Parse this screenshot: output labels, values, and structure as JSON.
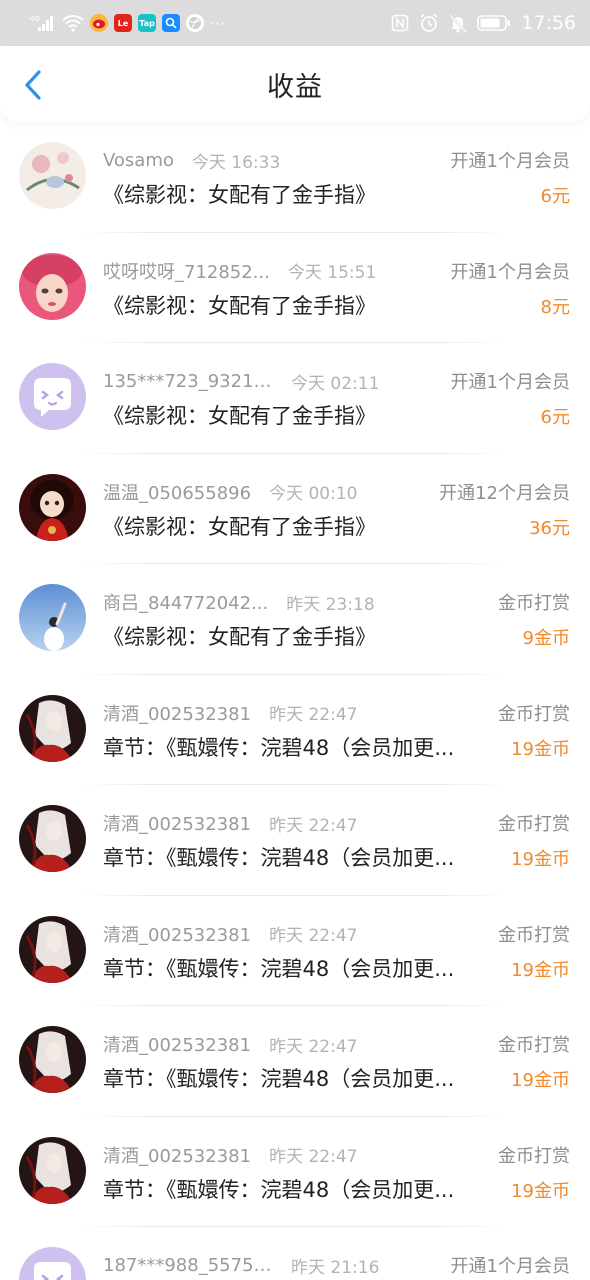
{
  "status_bar": {
    "network": "4G",
    "time": "17:56",
    "more": "···"
  },
  "header": {
    "title": "收益",
    "back_icon": "chevron-left-icon"
  },
  "colors": {
    "accent_back": "#2f8ef0",
    "amount": "#f08a2c"
  },
  "items": [
    {
      "user": "Vosamo",
      "time": "今天 16:33",
      "type": "开通1个月会员",
      "title": "《综影视：女配有了金手指》",
      "amount": "6元",
      "avatar": "avatar-floral"
    },
    {
      "user": "哎呀哎呀_712852...",
      "time": "今天 15:51",
      "type": "开通1个月会员",
      "title": "《综影视：女配有了金手指》",
      "amount": "8元",
      "avatar": "avatar-girl-pink"
    },
    {
      "user": "135***723_93219...",
      "time": "今天 02:11",
      "type": "开通1个月会员",
      "title": "《综影视：女配有了金手指》",
      "amount": "6元",
      "avatar": "avatar-default"
    },
    {
      "user": "温温_050655896",
      "time": "今天 00:10",
      "type": "开通12个月会员",
      "title": "《综影视：女配有了金手指》",
      "amount": "36元",
      "avatar": "avatar-doll"
    },
    {
      "user": "商吕_844772042...",
      "time": "昨天 23:18",
      "type": "金币打赏",
      "title": "《综影视：女配有了金手指》",
      "amount": "9金币",
      "avatar": "avatar-sky"
    },
    {
      "user": "清酒_002532381",
      "time": "昨天 22:47",
      "type": "金币打赏",
      "title": "章节：《甄嬛传：浣碧48（会员加更...",
      "amount": "19金币",
      "avatar": "avatar-dark"
    },
    {
      "user": "清酒_002532381",
      "time": "昨天 22:47",
      "type": "金币打赏",
      "title": "章节：《甄嬛传：浣碧48（会员加更...",
      "amount": "19金币",
      "avatar": "avatar-dark"
    },
    {
      "user": "清酒_002532381",
      "time": "昨天 22:47",
      "type": "金币打赏",
      "title": "章节：《甄嬛传：浣碧48（会员加更...",
      "amount": "19金币",
      "avatar": "avatar-dark"
    },
    {
      "user": "清酒_002532381",
      "time": "昨天 22:47",
      "type": "金币打赏",
      "title": "章节：《甄嬛传：浣碧48（会员加更...",
      "amount": "19金币",
      "avatar": "avatar-dark"
    },
    {
      "user": "清酒_002532381",
      "time": "昨天 22:47",
      "type": "金币打赏",
      "title": "章节：《甄嬛传：浣碧48（会员加更...",
      "amount": "19金币",
      "avatar": "avatar-dark"
    },
    {
      "user": "187***988_55750...",
      "time": "昨天 21:16",
      "type": "开通1个月会员",
      "title": "",
      "amount": "",
      "avatar": "avatar-default"
    }
  ]
}
